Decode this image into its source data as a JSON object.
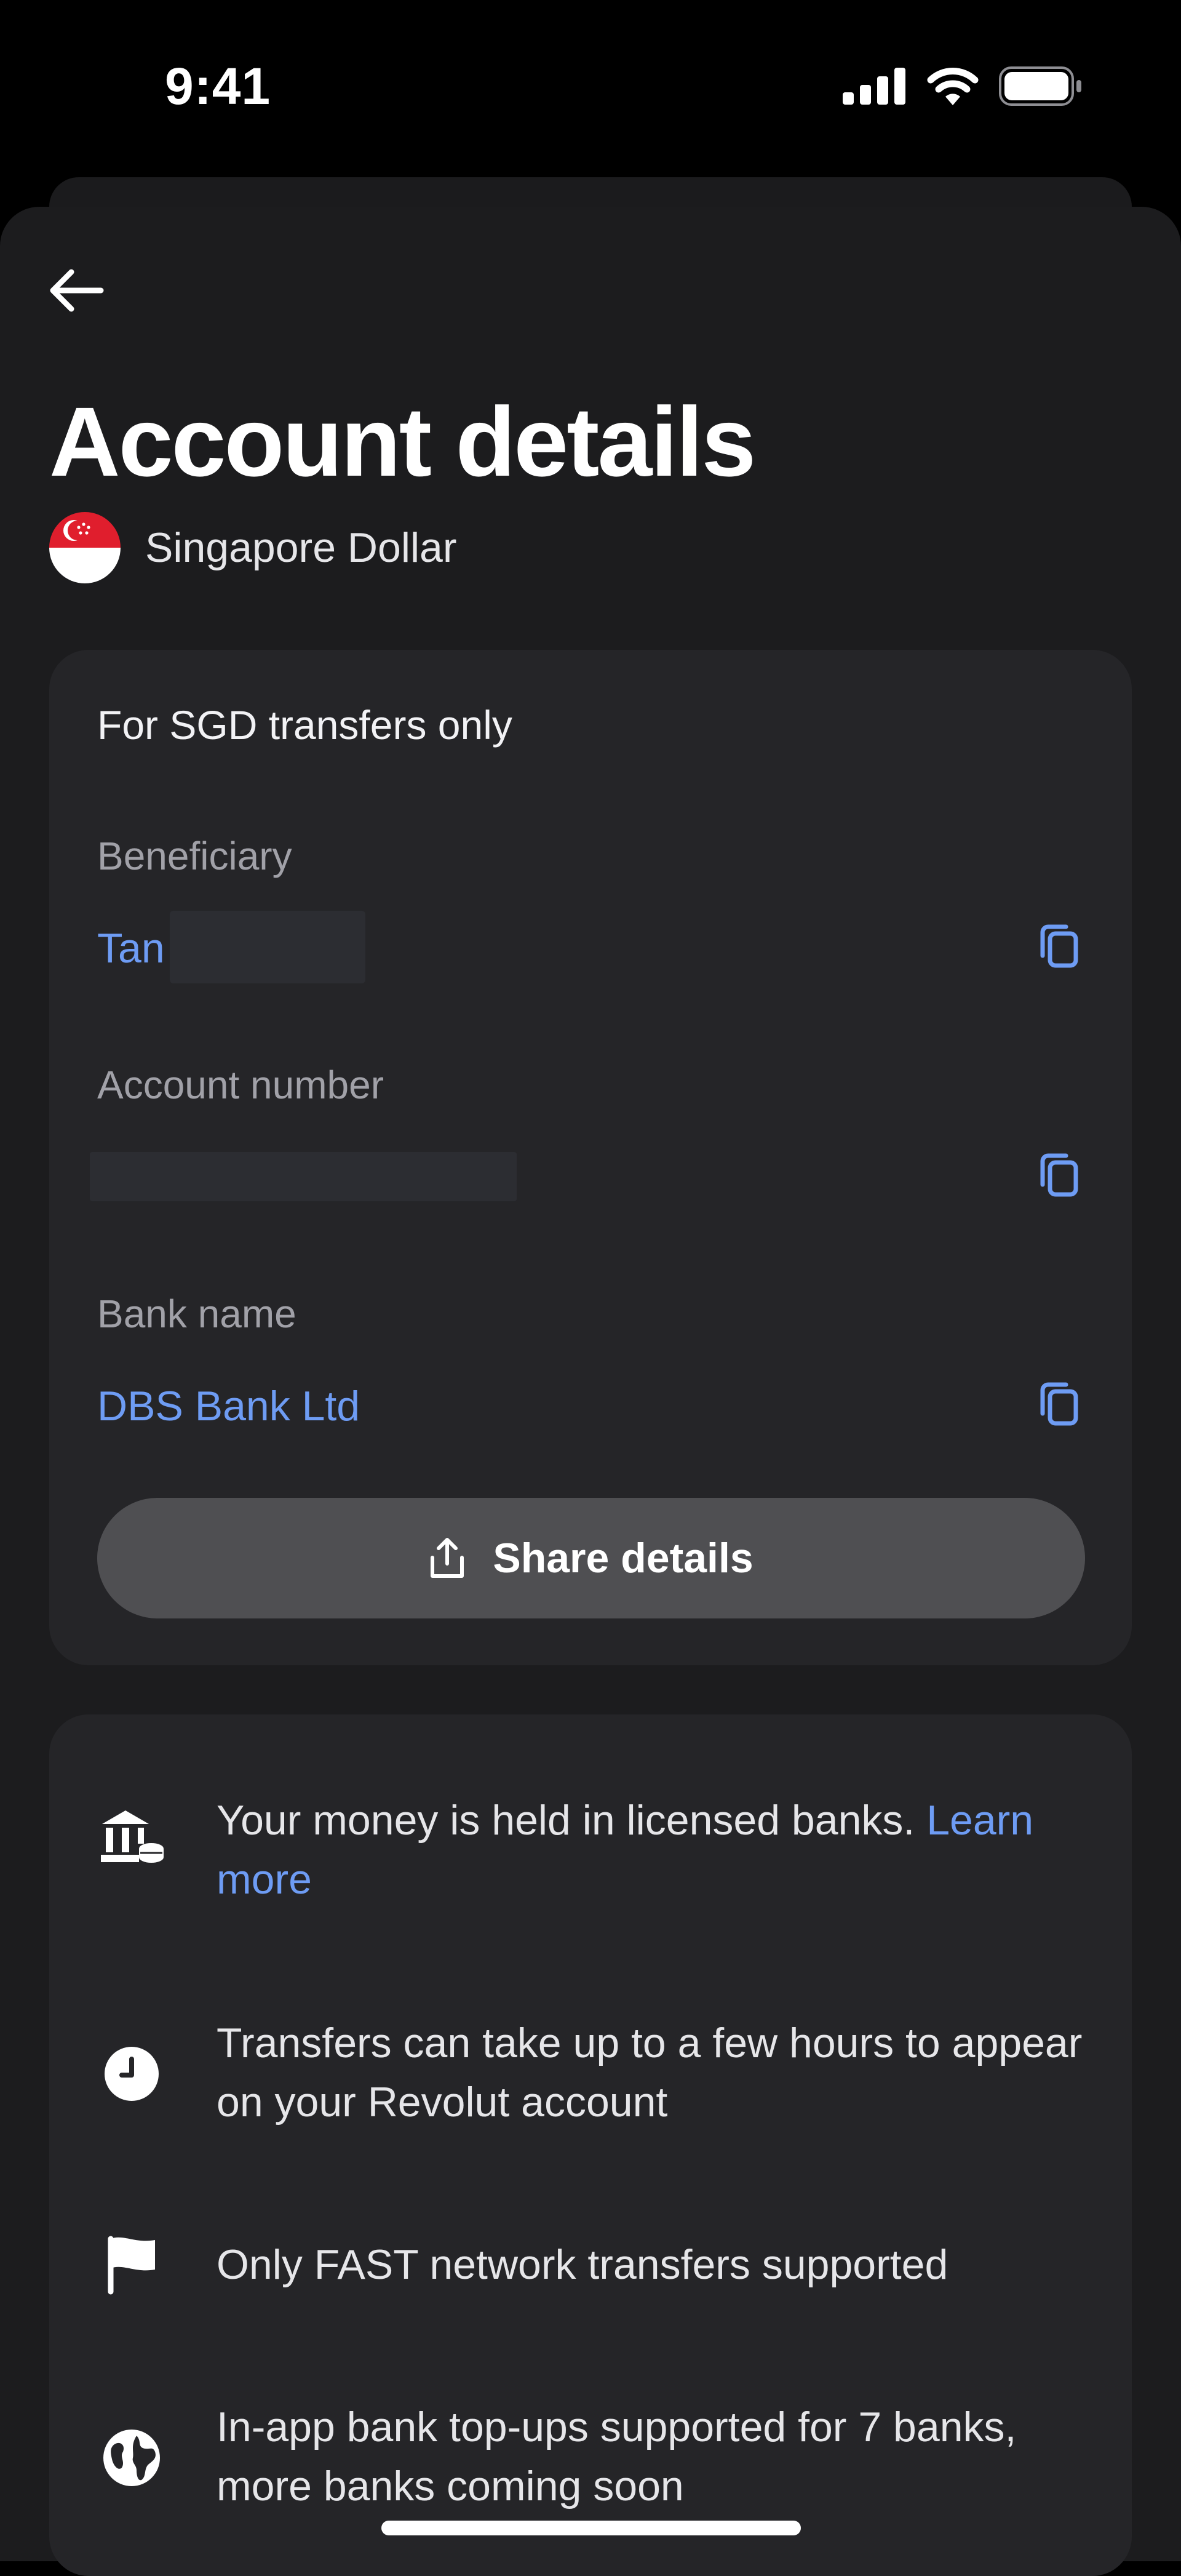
{
  "status_bar": {
    "time": "9:41",
    "icons": [
      "cellular-signal-icon",
      "wifi-icon",
      "battery-icon"
    ]
  },
  "header": {
    "back_icon": "arrow-left-icon",
    "title": "Account details",
    "currency": {
      "flag_icon": "singapore-flag-icon",
      "name": "Singapore Dollar"
    }
  },
  "details_card": {
    "heading": "For SGD transfers only",
    "fields": [
      {
        "label": "Beneficiary",
        "value": "Tan",
        "copy_icon": "copy-icon"
      },
      {
        "label": "Account number",
        "value": "",
        "copy_icon": "copy-icon"
      },
      {
        "label": "Bank name",
        "value": "DBS Bank Ltd",
        "copy_icon": "copy-icon"
      }
    ],
    "share_button": {
      "icon": "share-icon",
      "label": "Share details"
    }
  },
  "info_card": {
    "items": [
      {
        "icon": "bank-icon",
        "text": "Your money is held in licensed banks. ",
        "link": "Learn more"
      },
      {
        "icon": "clock-icon",
        "text": "Transfers can take up to a few hours to appear on your Revolut account"
      },
      {
        "icon": "flag-icon",
        "text": "Only FAST network transfers supported"
      },
      {
        "icon": "globe-icon",
        "text": "In-app bank top-ups supported for 7 banks, more banks coming soon"
      }
    ]
  },
  "colors": {
    "background": "#000000",
    "sheet": "#1c1c1e",
    "card": "#252528",
    "accent": "#6e9cf4",
    "muted_text": "#a1a1a8",
    "button": "#4f4f52"
  }
}
